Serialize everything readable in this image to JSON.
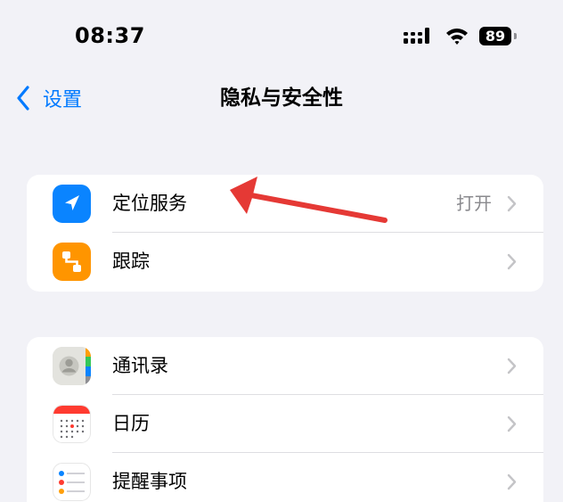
{
  "status_bar": {
    "time": "08:37",
    "battery_level": "89"
  },
  "nav": {
    "back_label": "设置",
    "title": "隐私与安全性"
  },
  "groups": [
    {
      "rows": [
        {
          "label": "定位服务",
          "value": "打开",
          "icon": "location-arrow-icon",
          "icon_color": "#0a84ff"
        },
        {
          "label": "跟踪",
          "value": "",
          "icon": "tracking-icon",
          "icon_color": "#ff9500"
        }
      ]
    },
    {
      "rows": [
        {
          "label": "通讯录",
          "icon": "contacts-icon"
        },
        {
          "label": "日历",
          "icon": "calendar-icon"
        },
        {
          "label": "提醒事项",
          "icon": "reminders-icon"
        }
      ]
    }
  ],
  "colors": {
    "background": "#f2f2f7",
    "accent": "#007aff",
    "annotation_arrow": "#e53935"
  }
}
